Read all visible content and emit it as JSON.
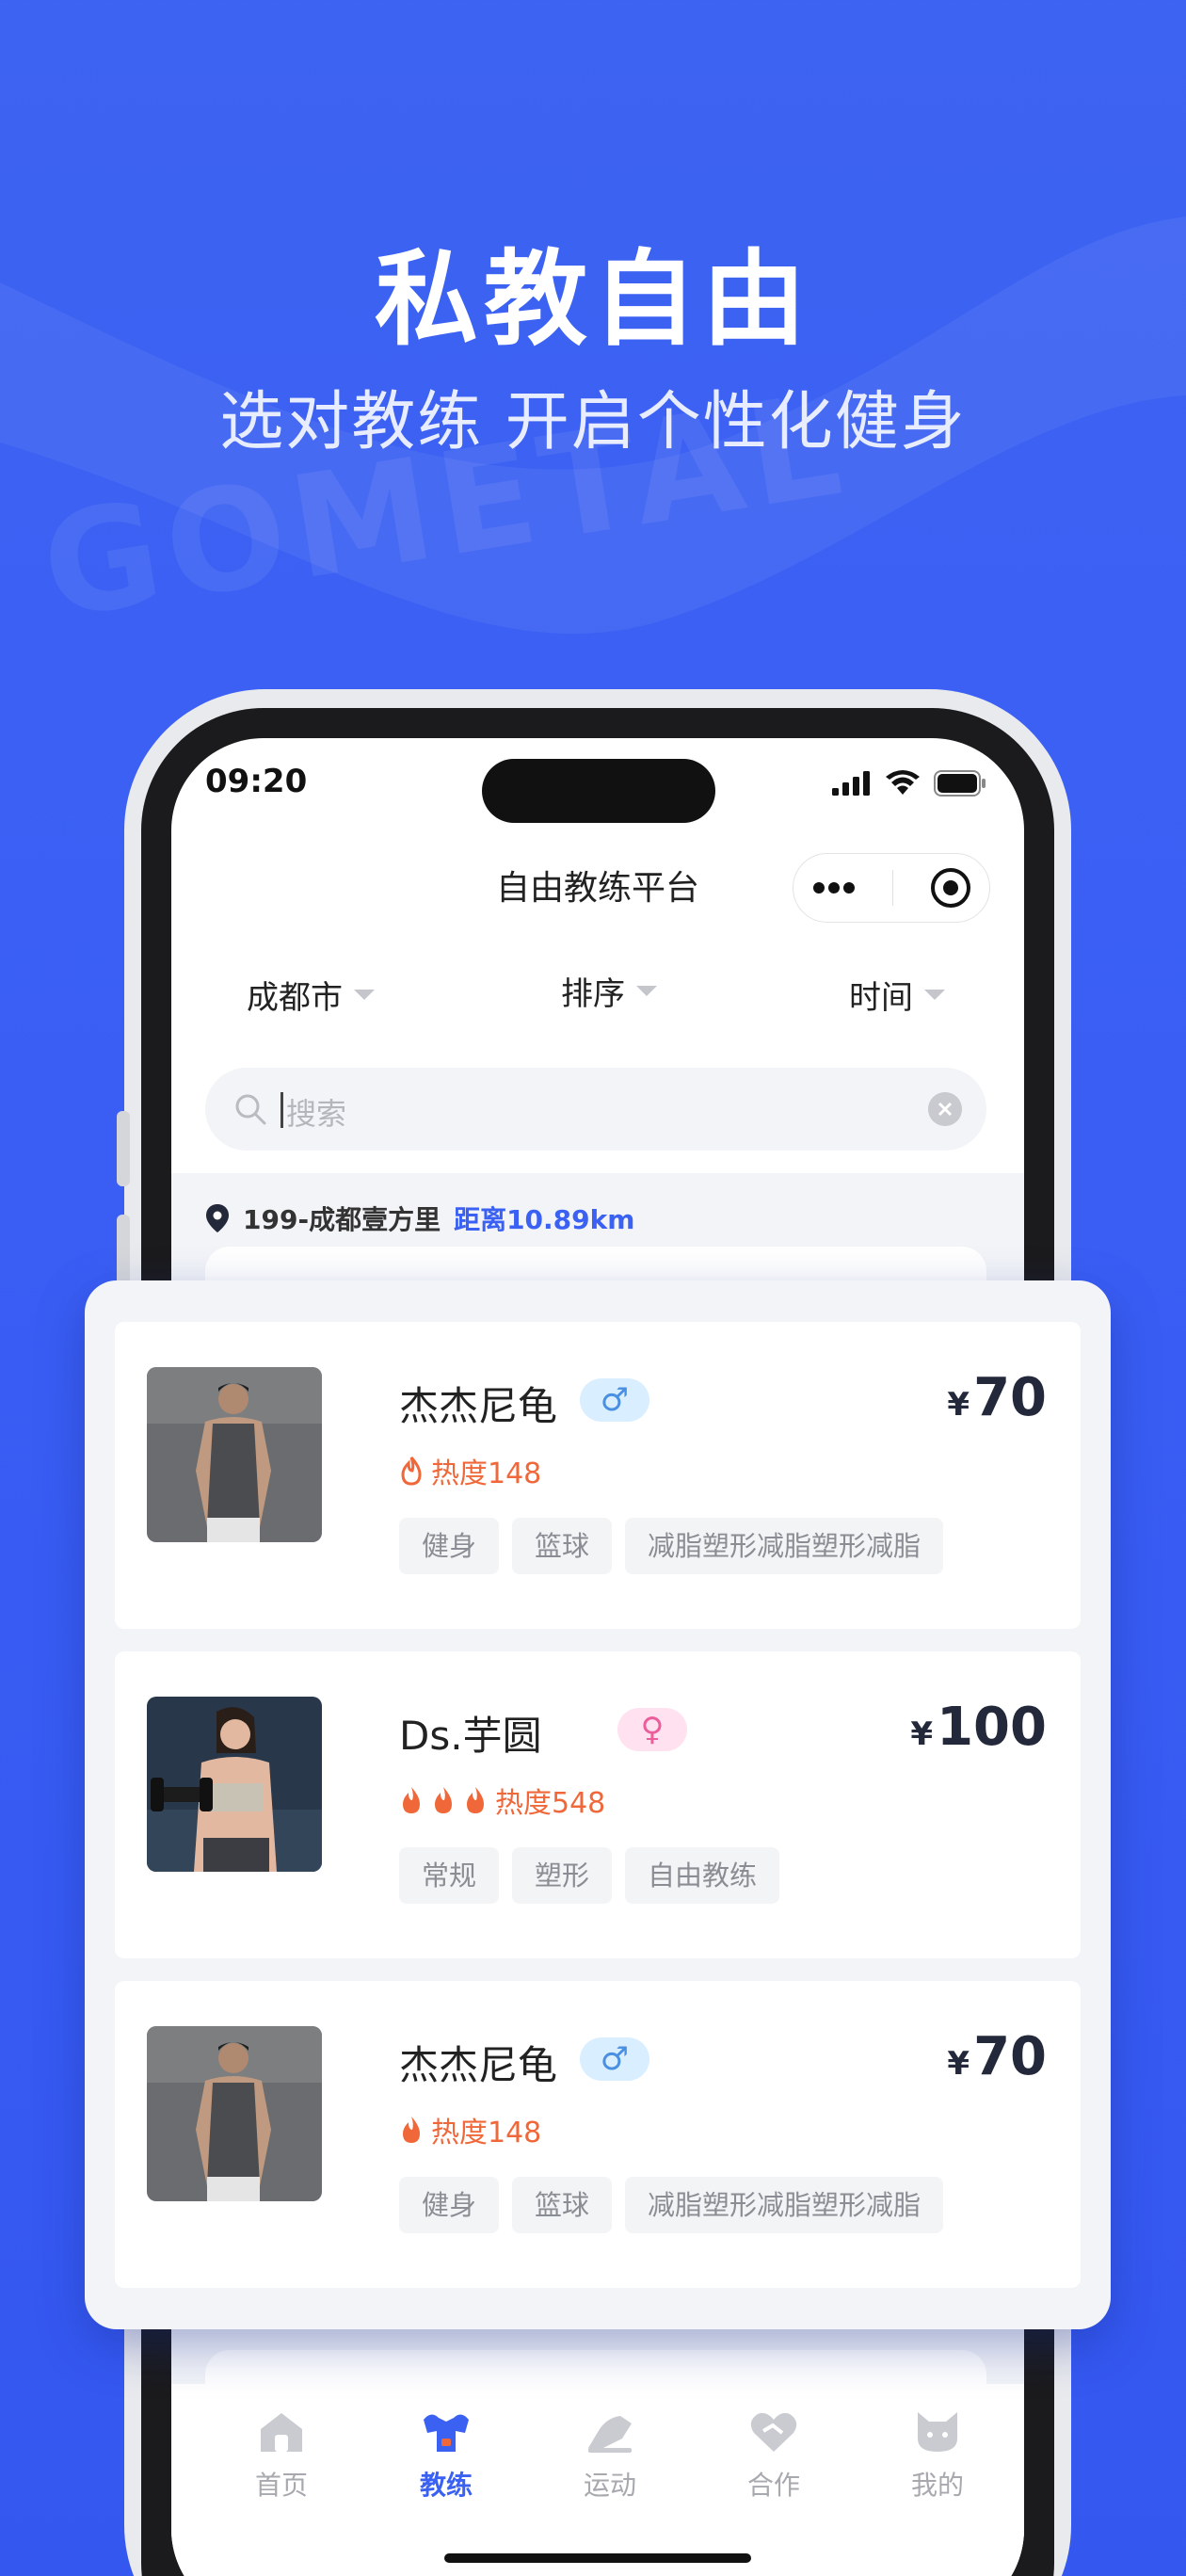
{
  "hero": {
    "title": "私教自由",
    "subtitle": "选对教练 开启个性化健身",
    "watermark": "GOMETAL"
  },
  "status_bar": {
    "time": "09:20"
  },
  "nav": {
    "title": "自由教练平台"
  },
  "filters": {
    "city": "成都市",
    "sort": "排序",
    "time": "时间"
  },
  "search": {
    "placeholder": "搜索"
  },
  "location": {
    "name": "199-成都壹方里",
    "distance": "距离10.89km"
  },
  "coaches": [
    {
      "name": "杰杰尼龟",
      "gender": "male",
      "gender_symbol": "♂",
      "heat_label": "热度148",
      "flames": 1,
      "price_symbol": "¥",
      "price": "70",
      "tags": [
        "健身",
        "篮球",
        "减脂塑形减脂塑形减脂"
      ]
    },
    {
      "name": "Ds.芋圆",
      "gender": "female",
      "gender_symbol": "♀",
      "heat_label": "热度548",
      "flames": 3,
      "price_symbol": "¥",
      "price": "100",
      "tags": [
        "常规",
        "塑形",
        "自由教练"
      ]
    },
    {
      "name": "杰杰尼龟",
      "gender": "male",
      "gender_symbol": "♂",
      "heat_label": "热度148",
      "flames": 1,
      "price_symbol": "¥",
      "price": "70",
      "tags": [
        "健身",
        "篮球",
        "减脂塑形减脂塑形减脂"
      ]
    }
  ],
  "tabbar": {
    "items": [
      {
        "label": "首页",
        "icon": "home-icon",
        "active": false
      },
      {
        "label": "教练",
        "icon": "coach-icon",
        "active": true
      },
      {
        "label": "运动",
        "icon": "sport-icon",
        "active": false
      },
      {
        "label": "合作",
        "icon": "cooperation-icon",
        "active": false
      },
      {
        "label": "我的",
        "icon": "profile-icon",
        "active": false
      }
    ]
  },
  "colors": {
    "brand_blue": "#3b61f2",
    "heat_orange": "#f0683a",
    "price_dark": "#23283a"
  }
}
